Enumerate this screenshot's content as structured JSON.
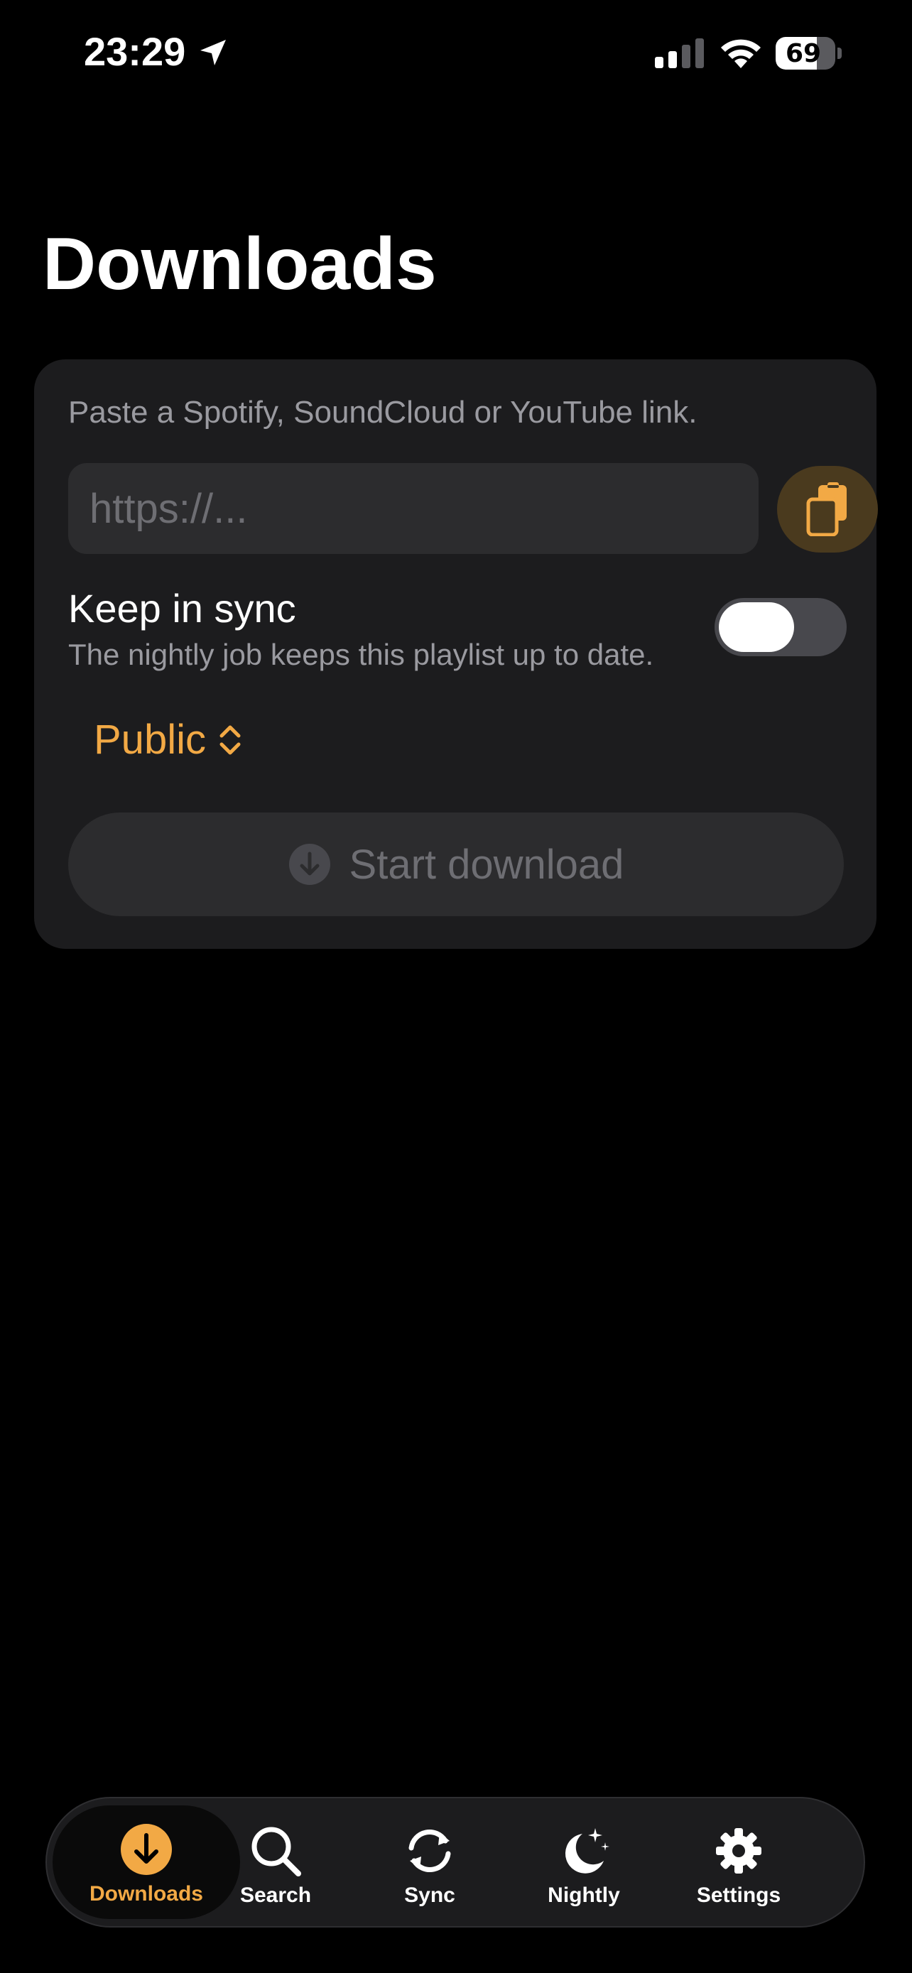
{
  "status_bar": {
    "time": "23:29",
    "battery_level": "69",
    "battery_fraction": 0.69
  },
  "page": {
    "title": "Downloads"
  },
  "card": {
    "hint": "Paste a Spotify, SoundCloud or YouTube link.",
    "url_value": "",
    "url_placeholder": "https://...",
    "paste_icon": "clipboard-icon",
    "sync": {
      "label": "Keep in sync",
      "description": "The nightly job keeps this playlist up to date.",
      "enabled": false
    },
    "visibility": {
      "selected": "Public"
    },
    "start_button": {
      "label": "Start download",
      "enabled": false
    }
  },
  "tab_bar": {
    "tabs": [
      {
        "label": "Downloads",
        "icon": "download-icon",
        "active": true
      },
      {
        "label": "Search",
        "icon": "search-icon",
        "active": false
      },
      {
        "label": "Sync",
        "icon": "sync-icon",
        "active": false
      },
      {
        "label": "Nightly",
        "icon": "moon-stars-icon",
        "active": false
      },
      {
        "label": "Settings",
        "icon": "gear-icon",
        "active": false
      }
    ]
  },
  "colors": {
    "accent": "#f2a945",
    "background": "#000000",
    "card": "#1c1c1e",
    "field": "#2c2c2e",
    "secondary_text": "#9a9aa0"
  }
}
